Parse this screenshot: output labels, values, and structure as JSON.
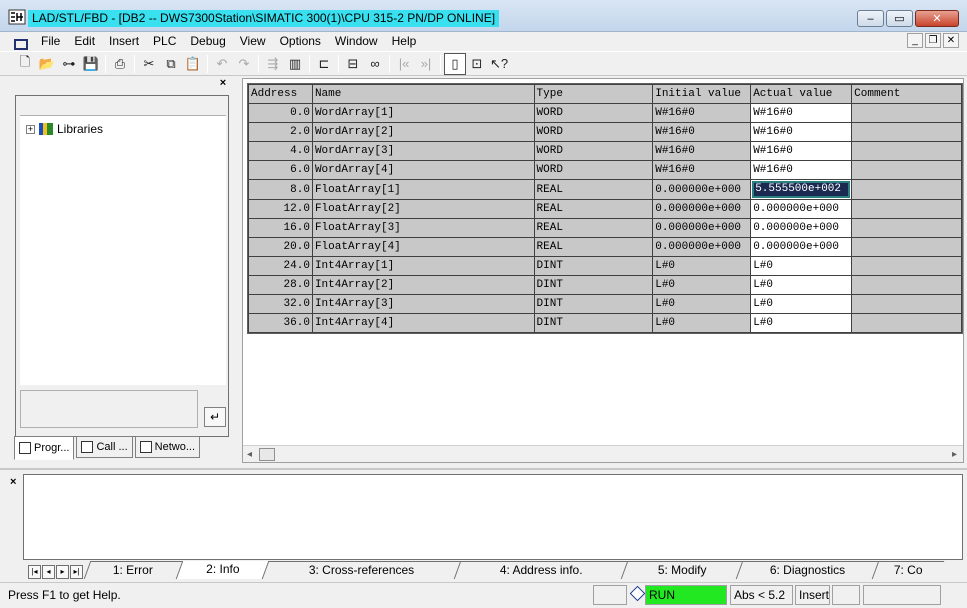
{
  "window": {
    "title": "LAD/STL/FBD  - [DB2 -- DWS7300Station\\SIMATIC 300(1)\\CPU 315-2 PN/DP  ONLINE]",
    "buttons": {
      "minimize": "–",
      "restore": "▭",
      "close": "✕"
    }
  },
  "menu": [
    "File",
    "Edit",
    "Insert",
    "PLC",
    "Debug",
    "View",
    "Options",
    "Window",
    "Help"
  ],
  "mdi_controls": {
    "minimize": "_",
    "restore": "❐",
    "close": "✕"
  },
  "toolbar": {
    "icons": [
      "new-icon",
      "open-icon",
      "accessible-nodes-icon",
      "save-icon",
      "print-icon",
      "cut-icon",
      "copy-icon",
      "paste-icon",
      "undo-icon",
      "redo-icon",
      "load-icon",
      "monitor-icon",
      "overview-icon",
      "details-icon",
      "glasses-icon",
      "prev-icon",
      "next-icon",
      "window-icon",
      "zoom-icon",
      "help-icon"
    ]
  },
  "left_panel": {
    "tree_items": [
      {
        "label": "Libraries",
        "icon": "libraries-icon"
      }
    ],
    "tabs": [
      "Progr...",
      "Call ...",
      "Netwo..."
    ]
  },
  "table": {
    "headers": [
      "Address",
      "Name",
      "Type",
      "Initial value",
      "Actual value",
      "Comment"
    ],
    "rows": [
      {
        "address": "0.0",
        "name": "WordArray[1]",
        "type": "WORD",
        "initial": "W#16#0",
        "actual": "W#16#0",
        "comment": ""
      },
      {
        "address": "2.0",
        "name": "WordArray[2]",
        "type": "WORD",
        "initial": "W#16#0",
        "actual": "W#16#0",
        "comment": ""
      },
      {
        "address": "4.0",
        "name": "WordArray[3]",
        "type": "WORD",
        "initial": "W#16#0",
        "actual": "W#16#0",
        "comment": ""
      },
      {
        "address": "6.0",
        "name": "WordArray[4]",
        "type": "WORD",
        "initial": "W#16#0",
        "actual": "W#16#0",
        "comment": ""
      },
      {
        "address": "8.0",
        "name": "FloatArray[1]",
        "type": "REAL",
        "initial": "0.000000e+000",
        "actual": "5.555500e+002",
        "comment": "",
        "editing": true
      },
      {
        "address": "12.0",
        "name": "FloatArray[2]",
        "type": "REAL",
        "initial": "0.000000e+000",
        "actual": "0.000000e+000",
        "comment": ""
      },
      {
        "address": "16.0",
        "name": "FloatArray[3]",
        "type": "REAL",
        "initial": "0.000000e+000",
        "actual": "0.000000e+000",
        "comment": ""
      },
      {
        "address": "20.0",
        "name": "FloatArray[4]",
        "type": "REAL",
        "initial": "0.000000e+000",
        "actual": "0.000000e+000",
        "comment": ""
      },
      {
        "address": "24.0",
        "name": "Int4Array[1]",
        "type": "DINT",
        "initial": "L#0",
        "actual": "L#0",
        "comment": ""
      },
      {
        "address": "28.0",
        "name": "Int4Array[2]",
        "type": "DINT",
        "initial": "L#0",
        "actual": "L#0",
        "comment": ""
      },
      {
        "address": "32.0",
        "name": "Int4Array[3]",
        "type": "DINT",
        "initial": "L#0",
        "actual": "L#0",
        "comment": ""
      },
      {
        "address": "36.0",
        "name": "Int4Array[4]",
        "type": "DINT",
        "initial": "L#0",
        "actual": "L#0",
        "comment": ""
      }
    ]
  },
  "output_tabs": [
    "1: Error",
    "2: Info",
    "3: Cross-references",
    "4: Address info.",
    "5: Modify",
    "6: Diagnostics",
    "7: Co"
  ],
  "output_active_tab": "2: Info",
  "status": {
    "help": "Press F1 to get Help.",
    "mode": "RUN",
    "abs": "Abs < 5.2",
    "insert": "Insert",
    "run_color": "#22e822"
  }
}
